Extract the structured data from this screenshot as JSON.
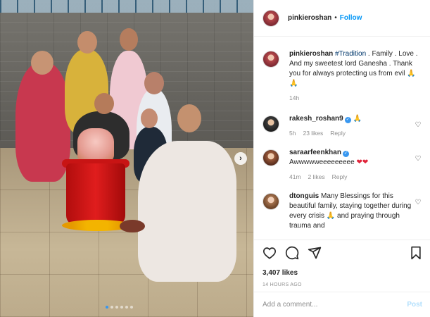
{
  "post": {
    "carousel": {
      "dot_count": 6,
      "active_index": 0
    }
  },
  "header": {
    "username": "pinkieroshan",
    "separator": "•",
    "follow_label": "Follow"
  },
  "caption": {
    "username": "pinkieroshan",
    "hashtag": "#Tradition",
    "text": " . Family . Love . And my sweetest lord Ganesha . Thank you for always protecting us from evil ",
    "emoji": "🙏🙏",
    "time": "14h"
  },
  "comments": [
    {
      "username": "rakesh_roshan9",
      "verified": true,
      "text": "",
      "emoji": "🙏",
      "time": "5h",
      "likes": "23 likes",
      "reply": "Reply"
    },
    {
      "username": "saraarfeenkhan",
      "verified": true,
      "text": "Awwwwweeeeeeeee",
      "emoji": "❤❤",
      "time": "41m",
      "likes": "2 likes",
      "reply": "Reply"
    },
    {
      "username": "dtonguis",
      "verified": false,
      "text": "Many Blessings for this beautiful family, staying together during every crisis ",
      "emoji": "🙏",
      "text2": " and praying through trauma and"
    }
  ],
  "actions": {
    "likes": "3,407 likes",
    "timestamp": "14 HOURS AGO"
  },
  "add_comment": {
    "placeholder": "Add a comment...",
    "post_label": "Post"
  },
  "colors": {
    "accent": "#0095f6",
    "post_disabled": "#b2dffc",
    "muted": "#8e8e8e",
    "text": "#262626"
  },
  "icons": {
    "like": "heart-icon",
    "comment": "comment-icon",
    "share": "share-icon",
    "save": "bookmark-icon",
    "next": "chevron-right-icon"
  }
}
